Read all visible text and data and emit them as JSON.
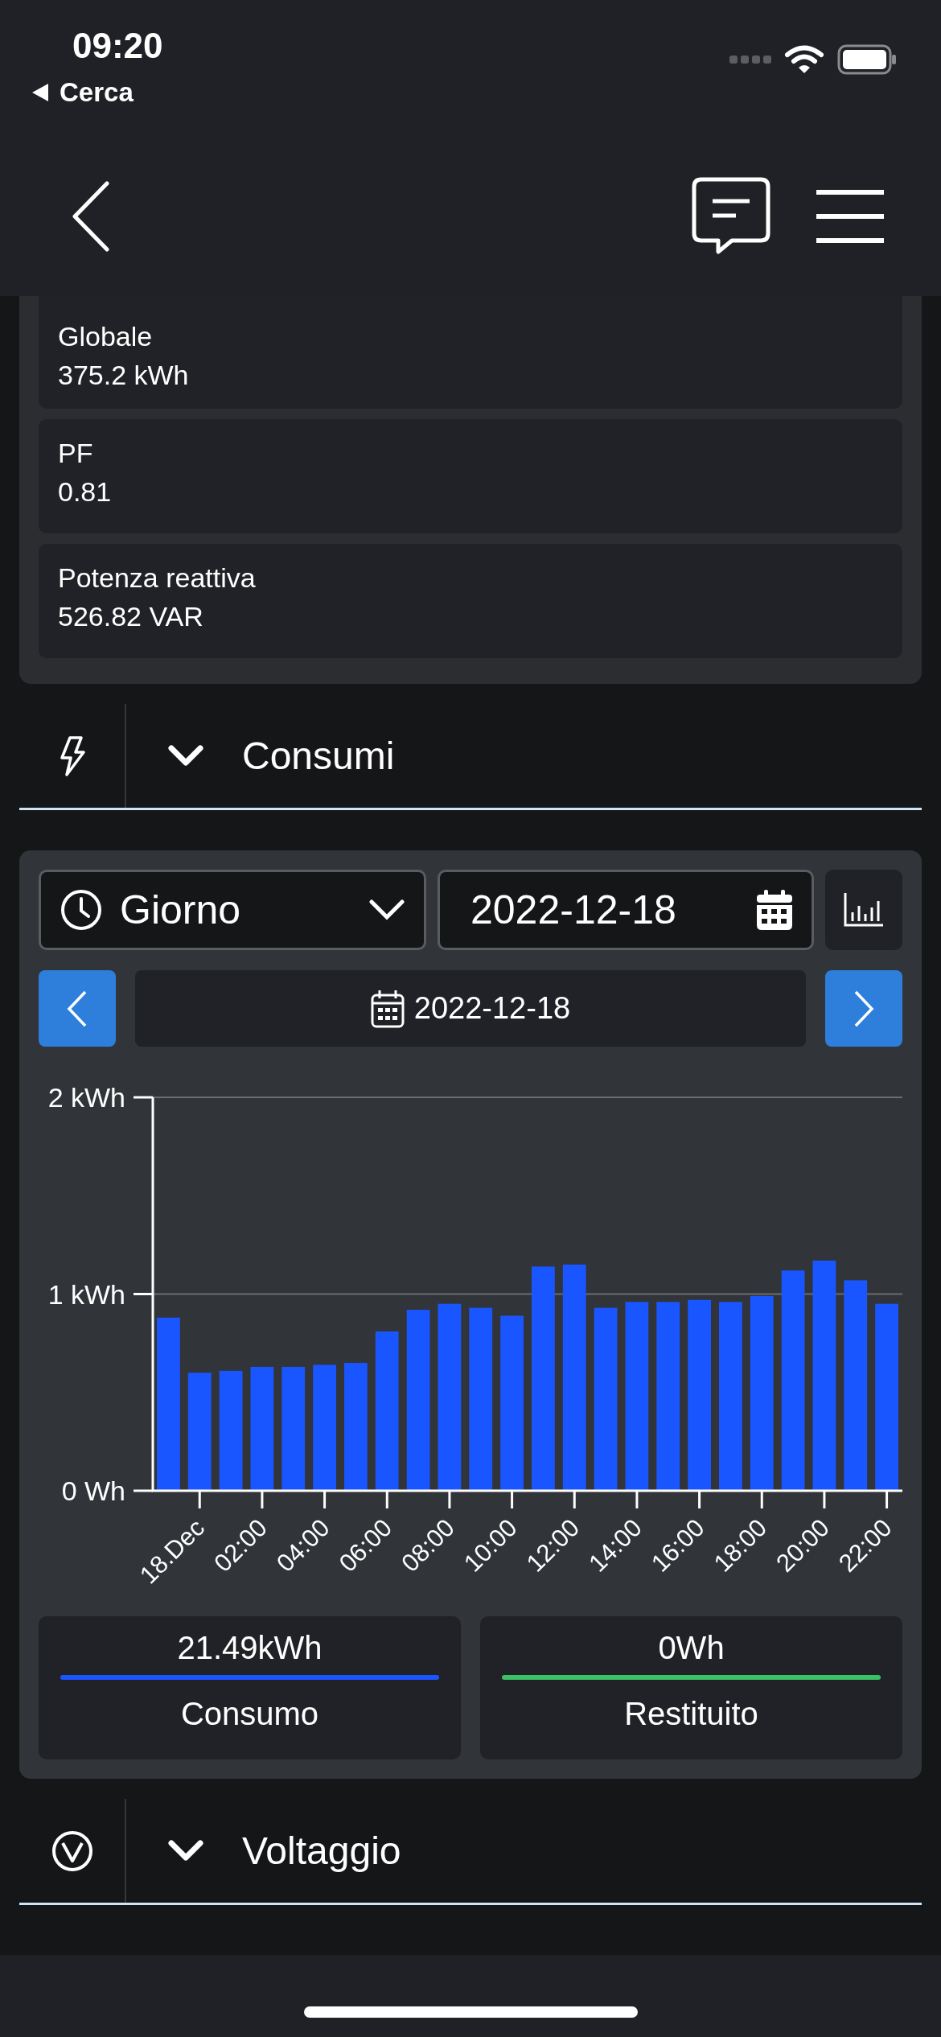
{
  "status_bar": {
    "time": "09:20",
    "back_label": "Cerca"
  },
  "metrics": [
    {
      "label": "Globale",
      "value": "375.2 kWh"
    },
    {
      "label": "PF",
      "value": "0.81"
    },
    {
      "label": "Potenza reattiva",
      "value": "526.82 VAR"
    }
  ],
  "sections": [
    {
      "title": "Consumi",
      "kind": "bolt"
    },
    {
      "title": "Voltaggio",
      "kind": "volt"
    }
  ],
  "consumption": {
    "period": {
      "value": "Giorno"
    },
    "date_field": {
      "value": "2022-12-18"
    },
    "nav_date": "2022-12-18",
    "chart_data": {
      "type": "bar",
      "categories": [
        null,
        "18.Dec",
        null,
        "02:00",
        null,
        "04:00",
        null,
        "06:00",
        null,
        "08:00",
        null,
        "10:00",
        null,
        "12:00",
        null,
        "14:00",
        null,
        "16:00",
        null,
        "18:00",
        null,
        "20:00",
        null,
        "22:00"
      ],
      "values": [
        0.88,
        0.6,
        0.61,
        0.63,
        0.63,
        0.64,
        0.65,
        0.81,
        0.92,
        0.95,
        0.93,
        0.89,
        1.14,
        1.15,
        0.93,
        0.96,
        0.96,
        0.97,
        0.96,
        0.99,
        1.12,
        1.17,
        1.07,
        0.95
      ],
      "ylim": [
        0,
        2
      ],
      "yticks": [
        {
          "value": 0,
          "label": "0 Wh"
        },
        {
          "value": 1,
          "label": "1 kWh"
        },
        {
          "value": 2,
          "label": "2 kWh"
        }
      ]
    },
    "totals": [
      {
        "value": "21.49kWh",
        "label": "Consumo",
        "color": "#1a56ff"
      },
      {
        "value": "0Wh",
        "label": "Restituito",
        "color": "#3cc065"
      }
    ]
  }
}
